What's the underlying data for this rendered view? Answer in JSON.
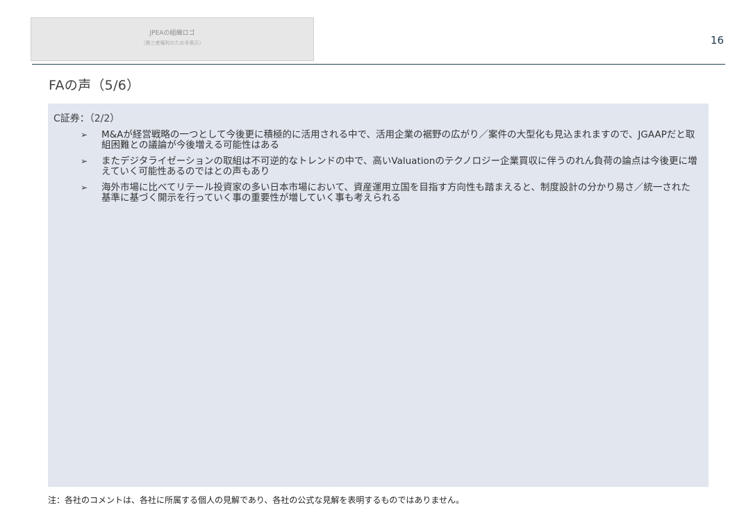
{
  "logo_placeholder": {
    "title": "JPEAの組織ロゴ",
    "note": "（第三者権利のため非表示）"
  },
  "page_number": "16",
  "title": "FAの声（5/6）",
  "section": {
    "heading": "C証券：（2/2）",
    "bullet_symbol": "➢",
    "bullets": [
      "M&Aが経営戦略の一つとして今後更に積極的に活用される中で、活用企業の裾野の広がり／案件の大型化も見込まれますので、JGAAPだと取組困難との議論が今後増える可能性はある",
      "またデジタライゼーションの取組は不可逆的なトレンドの中で、高いValuationのテクノロジー企業買収に伴うのれん負荷の論点は今後更に増えていく可能性あるのではとの声もあり",
      "海外市場に比べてリテール投資家の多い日本市場において、資産運用立国を目指す方向性も踏まえると、制度設計の分かり易さ／統一された基準に基づく開示を行っていく事の重要性が増していく事も考えられる"
    ]
  },
  "footnote": "注：各社のコメントは、各社に所属する個人の見解であり、各社の公式な見解を表明するものではありません。"
}
